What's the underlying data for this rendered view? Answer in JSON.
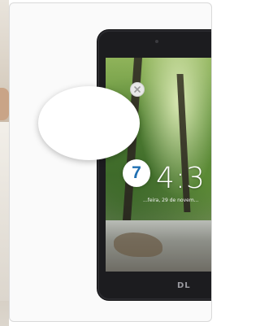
{
  "gallery": {
    "count_badge": "7",
    "accent_color": "#1f6fb2"
  },
  "device": {
    "lock_time": "4:3",
    "lock_date": "...feira, 29 de novem...",
    "brand": "DL"
  },
  "icons": {
    "close": "close-icon"
  }
}
